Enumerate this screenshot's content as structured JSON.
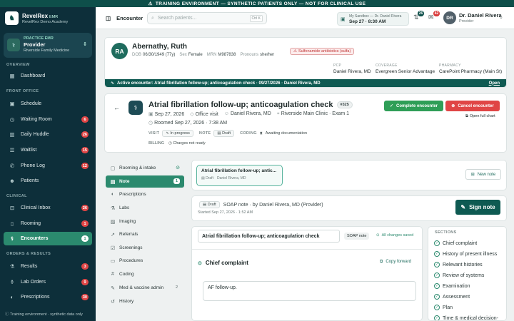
{
  "banner": {
    "text": "TRAINING ENVIRONMENT — SYNTHETIC PATIENTS ONLY — NOT FOR CLINICAL USE"
  },
  "brand": {
    "name": "RevelRex",
    "tag": "EMR",
    "sub": "RevelRex Demo Academy"
  },
  "practice": {
    "label": "PRACTICE EMR",
    "role": "Provider",
    "location": "Riverside Family Medicine"
  },
  "sidebar": {
    "sections": [
      {
        "title": "OVERVIEW",
        "items": [
          {
            "label": "Dashboard",
            "icon": "grid-icon"
          }
        ]
      },
      {
        "title": "FRONT OFFICE",
        "items": [
          {
            "label": "Schedule",
            "icon": "calendar-icon",
            "badge": ""
          },
          {
            "label": "Waiting Room",
            "icon": "clock-icon",
            "badge": "6"
          },
          {
            "label": "Daily Huddle",
            "icon": "chart-icon",
            "badge": "26"
          },
          {
            "label": "Waitlist",
            "icon": "list-icon",
            "badge": "15"
          },
          {
            "label": "Phone Log",
            "icon": "phone-icon",
            "badge": "12"
          },
          {
            "label": "Patients",
            "icon": "users-icon",
            "badge": ""
          }
        ]
      },
      {
        "title": "CLINICAL",
        "items": [
          {
            "label": "Clinical Inbox",
            "icon": "inbox-icon",
            "badge": "26"
          },
          {
            "label": "Rooming",
            "icon": "door-icon",
            "badge": "1"
          },
          {
            "label": "Encounters",
            "icon": "stethoscope-icon",
            "badge": "1"
          }
        ]
      },
      {
        "title": "ORDERS & RESULTS",
        "items": [
          {
            "label": "Results",
            "icon": "flask-icon",
            "badge": "3"
          },
          {
            "label": "Lab Orders",
            "icon": "beaker-icon",
            "badge": "9"
          },
          {
            "label": "Prescriptions",
            "icon": "pill-icon",
            "badge": "30"
          }
        ]
      }
    ],
    "footer": "Training environment · synthetic data only"
  },
  "topbar": {
    "section": "Encounter",
    "search_placeholder": "Search patients...",
    "search_shortcut": "Ctrl K",
    "sandbox_label": "My Sandbox — Dr. Daniel Rivera",
    "sandbox_date": "Sep 27 · 8:30 AM",
    "tasks_badge": "26",
    "messages_badge": "42",
    "user_initials": "DR",
    "user_name": "Dr. Daniel Rivera",
    "user_role": "Provider"
  },
  "patient": {
    "initials": "RA",
    "name": "Abernathy, Ruth",
    "dob_label": "DOB",
    "dob": "06/30/1949 (77y)",
    "sex_label": "Sex",
    "sex": "Female",
    "mrn_label": "MRN",
    "mrn": "M987838",
    "pronouns_label": "Pronouns",
    "pronouns": "she/her",
    "allergy": "Sulfonamide antibiotics (sulfa)",
    "pcp_label": "PCP",
    "pcp": "Daniel Rivera, MD",
    "coverage_label": "COVERAGE",
    "coverage": "Evergreen Senior Advantage",
    "pharmacy_label": "PHARMACY",
    "pharmacy": "CarePoint Pharmacy (Main St)",
    "active_encounter": "Active encounter: Atrial fibrillation follow-up; anticoagulation check · 09/27/2026 · Daniel Rivera, MD",
    "open_label": "Open"
  },
  "encounter": {
    "title": "Atrial fibrillation follow-up; anticoagulation check",
    "id": "#325",
    "date": "Sep 27, 2026",
    "type": "Office visit",
    "provider": "Daniel Rivera, MD",
    "location": "Riverside Main Clinic · Exam 1",
    "roomed": "Roomed Sep 27, 2026 · 7:38 AM",
    "visit_label": "VISIT",
    "visit_status": "In progress",
    "note_label": "NOTE",
    "note_status": "Draft",
    "coding_label": "CODING",
    "coding_status": "Awaiting documentation",
    "billing_label": "BILLING",
    "billing_status": "Charges not ready",
    "complete_label": "Complete encounter",
    "cancel_label": "Cancel encounter",
    "full_chart_label": "Open full chart"
  },
  "subnav": [
    {
      "label": "Rooming & intake",
      "icon": "clipboard-icon",
      "extra": "check"
    },
    {
      "label": "Note",
      "icon": "note-icon",
      "count": "1"
    },
    {
      "label": "Prescriptions",
      "icon": "pill-icon"
    },
    {
      "label": "Labs",
      "icon": "flask-icon"
    },
    {
      "label": "Imaging",
      "icon": "image-icon"
    },
    {
      "label": "Referrals",
      "icon": "share-icon"
    },
    {
      "label": "Screenings",
      "icon": "clipboard-check-icon"
    },
    {
      "label": "Procedures",
      "icon": "doc-icon"
    },
    {
      "label": "Coding",
      "icon": "hash-icon"
    },
    {
      "label": "Med & vaccine admin",
      "icon": "syringe-icon",
      "count": "2"
    },
    {
      "label": "History",
      "icon": "history-icon"
    }
  ],
  "notes": {
    "tab_title": "Atrial fibrillation follow-up; antic...",
    "tab_status": "Draft",
    "tab_author": "Daniel Rivera, MD",
    "new_note_label": "New note"
  },
  "soap": {
    "status": "Draft",
    "line": "SOAP note · by Daniel Rivera, MD (Provider)",
    "started": "Started Sep 27, 2026 · 1:52 AM",
    "sign_label": "Sign note"
  },
  "editor": {
    "title_value": "Atrial fibrillation follow-up; anticoagulation check",
    "type_tag": "SOAP note",
    "saved": "All changes saved",
    "section_title": "Chief complaint",
    "copy_forward": "Copy forward",
    "content": "AF follow-up."
  },
  "sections": {
    "header": "SECTIONS",
    "items": [
      "Chief complaint",
      "History of present illness",
      "Relevant histories",
      "Review of systems",
      "Examination",
      "Assessment",
      "Plan",
      "Time & medical decision-"
    ]
  },
  "colors": {
    "brand": "#0e4f4a",
    "accent": "#2b8a6e",
    "danger": "#e04545",
    "success": "#2f9e57"
  }
}
